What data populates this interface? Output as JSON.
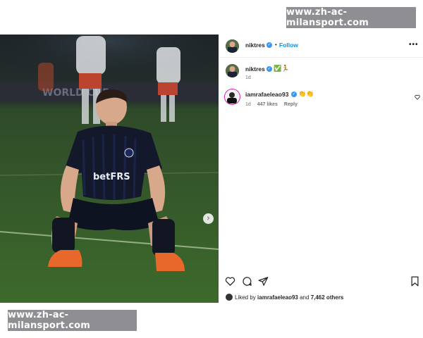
{
  "watermark": {
    "text": "www.zh-ac-milansport.com"
  },
  "post": {
    "author": "niktres",
    "follow_label": "Follow",
    "more_label": "•••",
    "separator": "•",
    "caption": {
      "username": "niktres",
      "emoji": "✅🏃",
      "time": "1d"
    },
    "comments": [
      {
        "username": "iamrafaeleao93",
        "emoji": "👏👏",
        "time": "1d",
        "likes": "447 likes",
        "reply_label": "Reply"
      }
    ],
    "liked_by": {
      "prefix": "Liked by",
      "user": "iamrafaeleao93",
      "and": "and",
      "others": "7,462 others"
    },
    "photo_text": {
      "sponsor": "betFRS",
      "banner": "WORLD CUP"
    }
  },
  "colors": {
    "link_blue": "#0095f6",
    "verified_blue": "#3897f0",
    "pitch_green": "#3d6a2b",
    "kit_navy": "#13182a",
    "boot_orange": "#e8672a"
  },
  "icons": {
    "verified": "verified-badge-icon",
    "more": "more-options-icon",
    "next": "chevron-right-icon",
    "like": "heart-icon",
    "comment": "comment-bubble-icon",
    "share": "paper-plane-icon",
    "save": "bookmark-icon"
  }
}
